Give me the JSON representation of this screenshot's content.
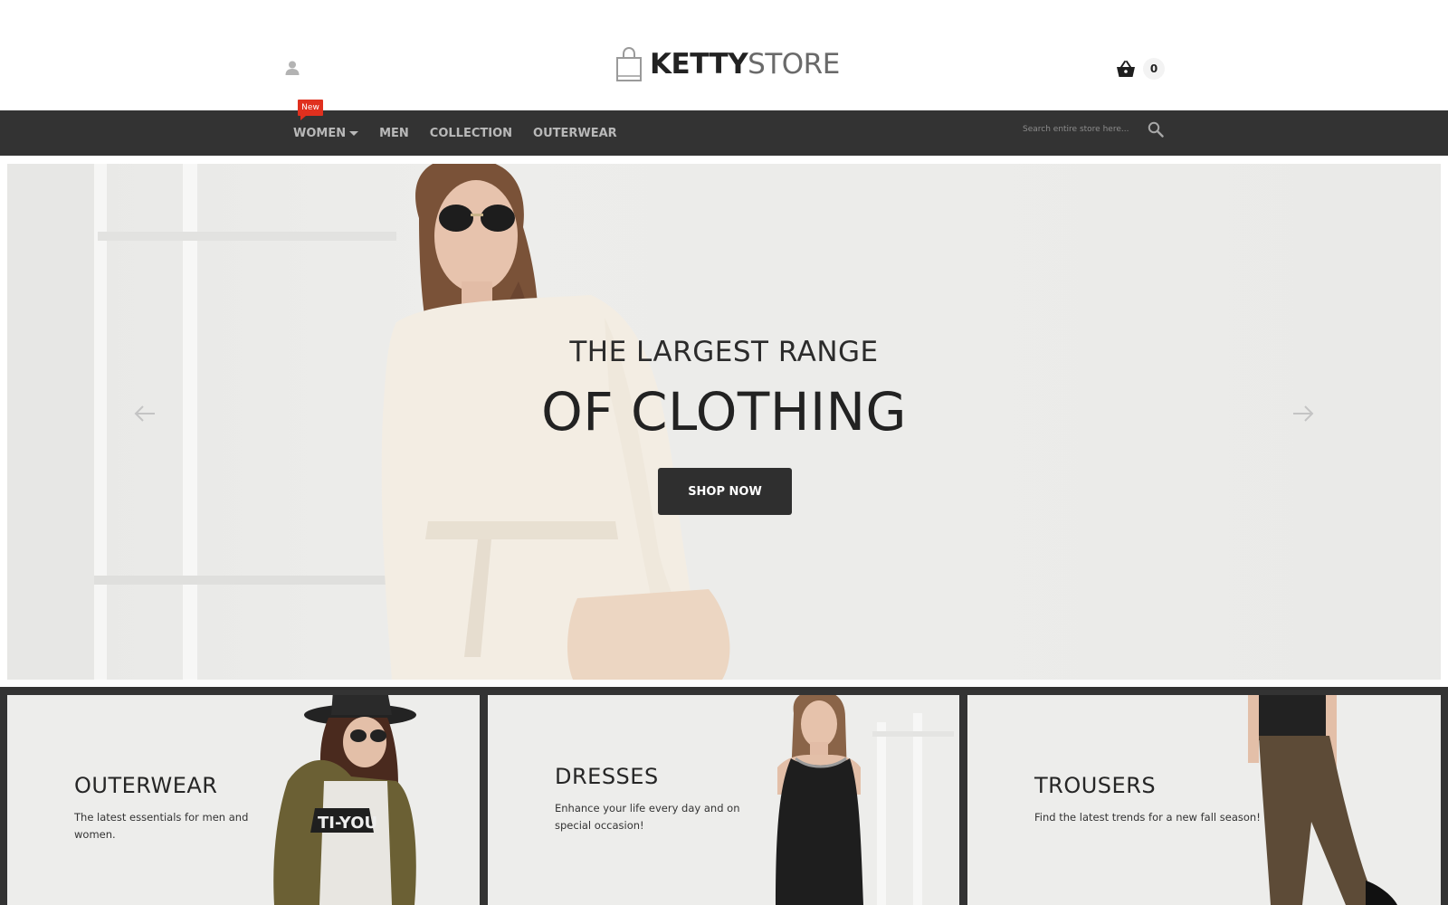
{
  "header": {
    "logo_bold": "KETTY",
    "logo_light": "STORE",
    "cart_count": "0"
  },
  "nav": {
    "new_badge": "New",
    "items": [
      {
        "label": "WOMEN"
      },
      {
        "label": "MEN"
      },
      {
        "label": "COLLECTION"
      },
      {
        "label": "OUTERWEAR"
      }
    ],
    "search_placeholder": "Search entire store here..."
  },
  "hero": {
    "title_small": "THE LARGEST RANGE",
    "title_big": "OF CLOTHING",
    "button": "SHOP NOW"
  },
  "categories": [
    {
      "title": "OUTERWEAR",
      "description": "The latest essentials for men and women."
    },
    {
      "title": "DRESSES",
      "description": "Enhance your life every day and on special occasion!"
    },
    {
      "title": "TROUSERS",
      "description": "Find the latest trends for a new fall season!"
    }
  ],
  "colors": {
    "nav_bg": "#333333",
    "badge": "#e0301e",
    "button_bg": "#2f2f2f"
  },
  "icons": {
    "account": "user-icon",
    "cart": "basket-icon",
    "search": "search-icon",
    "prev": "arrow-left-icon",
    "next": "arrow-right-icon",
    "logo": "shopping-bag-icon"
  }
}
